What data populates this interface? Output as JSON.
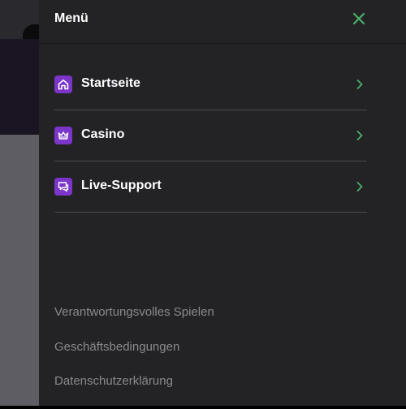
{
  "drawer": {
    "title": "Menü"
  },
  "menu": {
    "items": [
      {
        "label": "Startseite",
        "icon": "home-icon"
      },
      {
        "label": "Casino",
        "icon": "crown-icon"
      },
      {
        "label": "Live-Support",
        "icon": "chat-icon"
      }
    ]
  },
  "footer": {
    "links": [
      "Verantwortungsvolles Spielen",
      "Geschäftsbedingungen",
      "Datenschutzerklärung"
    ]
  },
  "colors": {
    "accent": "#7b35c9",
    "chevron": "#4caf6a",
    "close": "#4caf6a",
    "panel": "#232326"
  }
}
